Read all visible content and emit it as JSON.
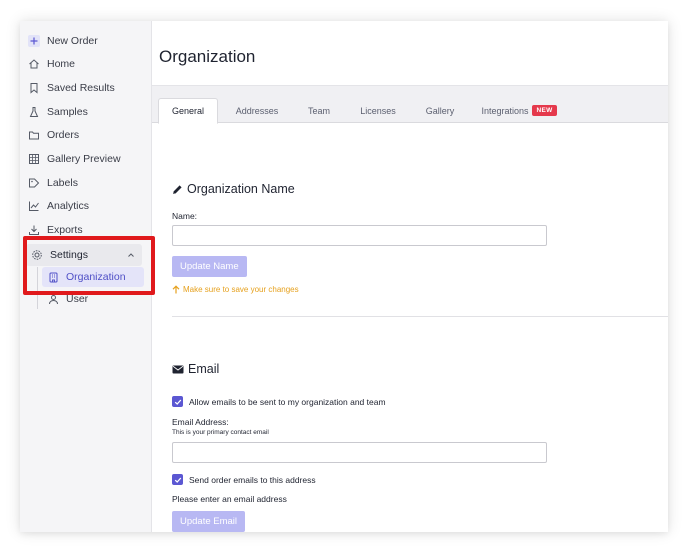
{
  "sidebar": {
    "items": [
      {
        "label": "New Order",
        "icon": "plus-icon"
      },
      {
        "label": "Home",
        "icon": "home-icon"
      },
      {
        "label": "Saved Results",
        "icon": "bookmark-icon"
      },
      {
        "label": "Samples",
        "icon": "flask-icon"
      },
      {
        "label": "Orders",
        "icon": "folder-icon"
      },
      {
        "label": "Gallery Preview",
        "icon": "grid-icon"
      },
      {
        "label": "Labels",
        "icon": "tag-icon"
      },
      {
        "label": "Analytics",
        "icon": "chart-icon"
      },
      {
        "label": "Exports",
        "icon": "download-icon"
      }
    ],
    "settings": {
      "label": "Settings",
      "icon": "gear-icon"
    },
    "subitems": [
      {
        "label": "Organization",
        "icon": "building-icon",
        "active": true
      },
      {
        "label": "User",
        "icon": "user-icon",
        "active": false
      }
    ]
  },
  "header": {
    "title": "Organization"
  },
  "tabs": [
    {
      "label": "General",
      "active": true
    },
    {
      "label": "Addresses"
    },
    {
      "label": "Team"
    },
    {
      "label": "Licenses"
    },
    {
      "label": "Gallery"
    },
    {
      "label": "Integrations",
      "badge": "NEW"
    }
  ],
  "org_name_section": {
    "title": "Organization Name",
    "icon": "pencil-icon",
    "name_label": "Name:",
    "name_value": "",
    "button_label": "Update Name",
    "warning": "Make sure to save your changes"
  },
  "email_section": {
    "title": "Email",
    "icon": "envelope-icon",
    "allow_emails_label": "Allow emails to be sent to my organization and team",
    "allow_emails_checked": true,
    "address_label": "Email Address:",
    "address_hint": "This is your primary contact email",
    "address_value": "",
    "send_orders_label": "Send order emails to this address",
    "send_orders_checked": true,
    "enter_email_message": "Please enter an email address",
    "button_label": "Update Email"
  },
  "colors": {
    "accent": "#5b57d2",
    "active_nav_bg": "#e4e4f9",
    "button_disabled": "#b8b8f3",
    "warning": "#e6a11e",
    "badge": "#e5394c",
    "highlight": "#e0191c"
  }
}
